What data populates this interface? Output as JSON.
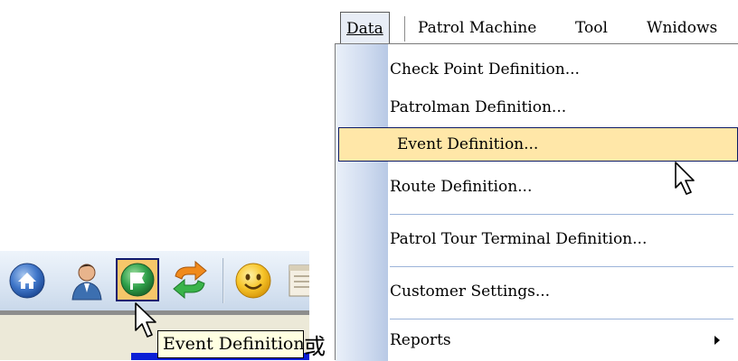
{
  "toolbar": {
    "tooltip": "Event Definition",
    "icons": [
      "home-icon",
      "user-icon",
      "event-flag-icon",
      "refresh-icon",
      "smiley-icon",
      "document-icon"
    ],
    "selected_icon": "event-flag-icon"
  },
  "or_text": "或",
  "menu": {
    "bar": [
      "Data",
      "Patrol Machine",
      "Tool",
      "Wnidows"
    ],
    "active_bar_item": "Data",
    "items": [
      {
        "label": "Check Point Definition..."
      },
      {
        "label": "Patrolman Definition..."
      },
      {
        "label": "Event Definition...",
        "highlighted": true
      },
      {
        "label": "Route Definition..."
      },
      {
        "label": "Patrol Tour Terminal Definition..."
      },
      {
        "label": "Customer Settings..."
      },
      {
        "label": "Reports",
        "has_submenu": true
      }
    ]
  },
  "colors": {
    "highlight": "#ffe7a8",
    "highlight_border": "#0b1a64",
    "tooltip_bg": "#ffffe1",
    "gutter": "#cfdbef"
  }
}
